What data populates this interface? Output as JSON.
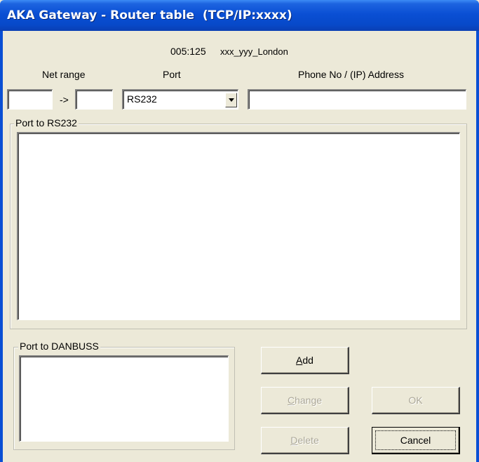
{
  "window": {
    "title": "AKA Gateway - Router table  (TCP/IP:xxxx)"
  },
  "header": {
    "node_id": "005:125",
    "node_name": "xxx_yyy_London"
  },
  "columns": {
    "net_range": "Net range",
    "port": "Port",
    "address": "Phone No / (IP) Address"
  },
  "net_range": {
    "from": "",
    "arrow": "->",
    "to": ""
  },
  "port_select": {
    "value": "RS232"
  },
  "address_field": {
    "value": ""
  },
  "groups": {
    "rs232": "Port to RS232",
    "danbuss": "Port to DANBUSS"
  },
  "buttons": {
    "add": {
      "label": "Add",
      "accel": "A",
      "rest": "dd",
      "enabled": true
    },
    "change": {
      "label": "Change",
      "accel": "C",
      "rest": "hange",
      "enabled": false
    },
    "delete": {
      "label": "Delete",
      "accel": "D",
      "rest": "elete",
      "enabled": false
    },
    "ok": {
      "label": "OK",
      "enabled": false
    },
    "cancel": {
      "label": "Cancel",
      "enabled": true
    }
  }
}
